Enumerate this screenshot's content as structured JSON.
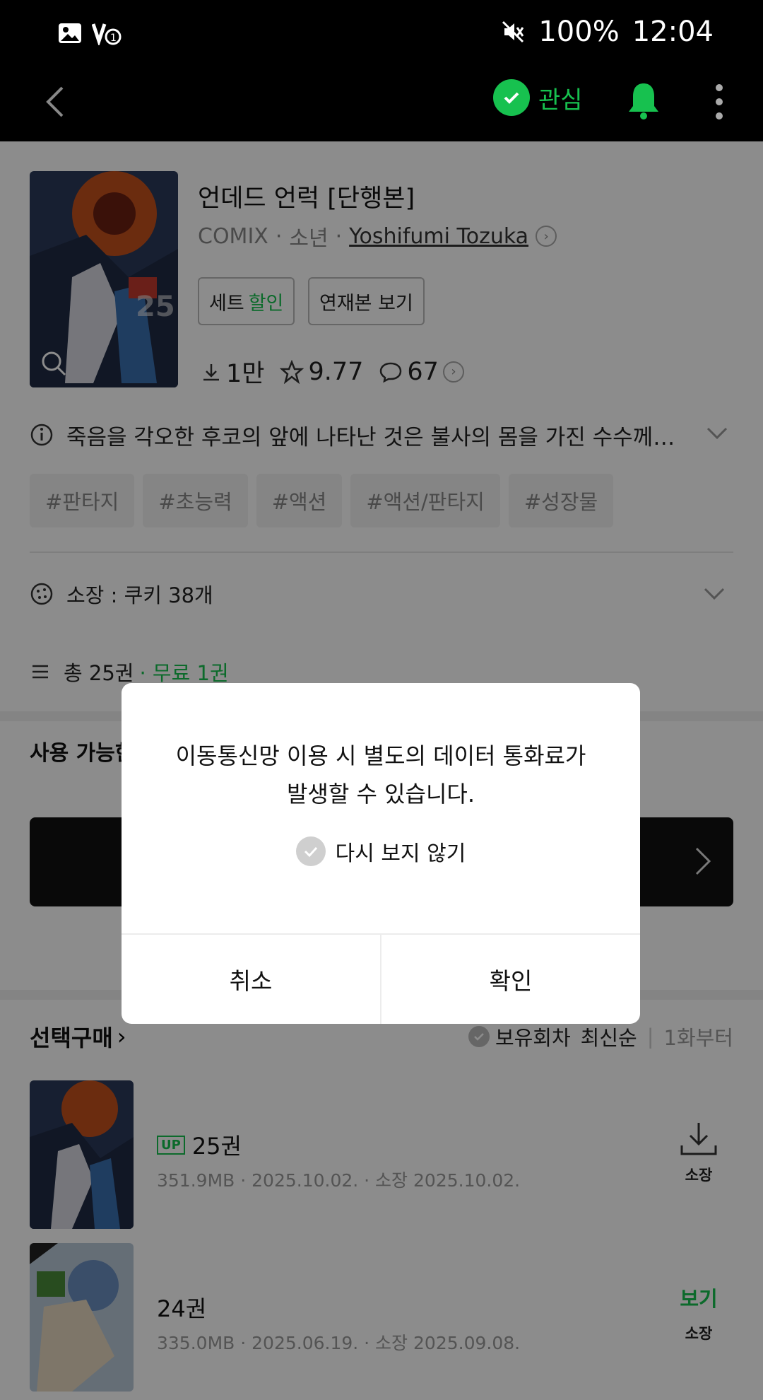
{
  "status_bar": {
    "battery": "100%",
    "time": "12:04"
  },
  "app_bar": {
    "favorite_label": "관심"
  },
  "book": {
    "title": "언데드 언럭 [단행본]",
    "publisher": "COMIX",
    "genre": "소년",
    "author": "Yoshifumi Tozuka",
    "set_label": "세트",
    "set_discount": "할인",
    "serial_button": "연재본 보기",
    "downloads": "1만",
    "rating": "9.77",
    "comments": "67",
    "description": "죽음을 각오한 후코의 앞에 나타난 것은 불사의 몸을 가진 수수께끼...",
    "tags": [
      "#판타지",
      "#초능력",
      "#액션",
      "#액션/판타지",
      "#성장물"
    ],
    "owned": "소장 : 쿠키 38개",
    "total_volumes": "총 25권",
    "free_volumes": "· 무료 1권"
  },
  "available_title": "사용 가능한",
  "selection": {
    "title": "선택구매",
    "owned_filter": "보유회차",
    "sort_latest": "최신순",
    "sort_from_first": "1화부터",
    "episodes": [
      {
        "badge": "UP",
        "title": "25권",
        "meta": "351.9MB · 2025.10.02. · 소장 2025.10.02.",
        "action": "소장"
      },
      {
        "title": "24권",
        "meta": "335.0MB · 2025.06.19. · 소장 2025.09.08.",
        "view": "보기",
        "action": "소장"
      }
    ]
  },
  "dialog": {
    "message_line1": "이동통신망 이용 시 별도의 데이터 통화료가",
    "message_line2": "발생할 수 있습니다.",
    "dont_show_again": "다시 보지 않기",
    "cancel": "취소",
    "confirm": "확인"
  },
  "colors": {
    "accent_green": "#17c14f",
    "overlay": "rgba(0,0,0,0.45)"
  }
}
